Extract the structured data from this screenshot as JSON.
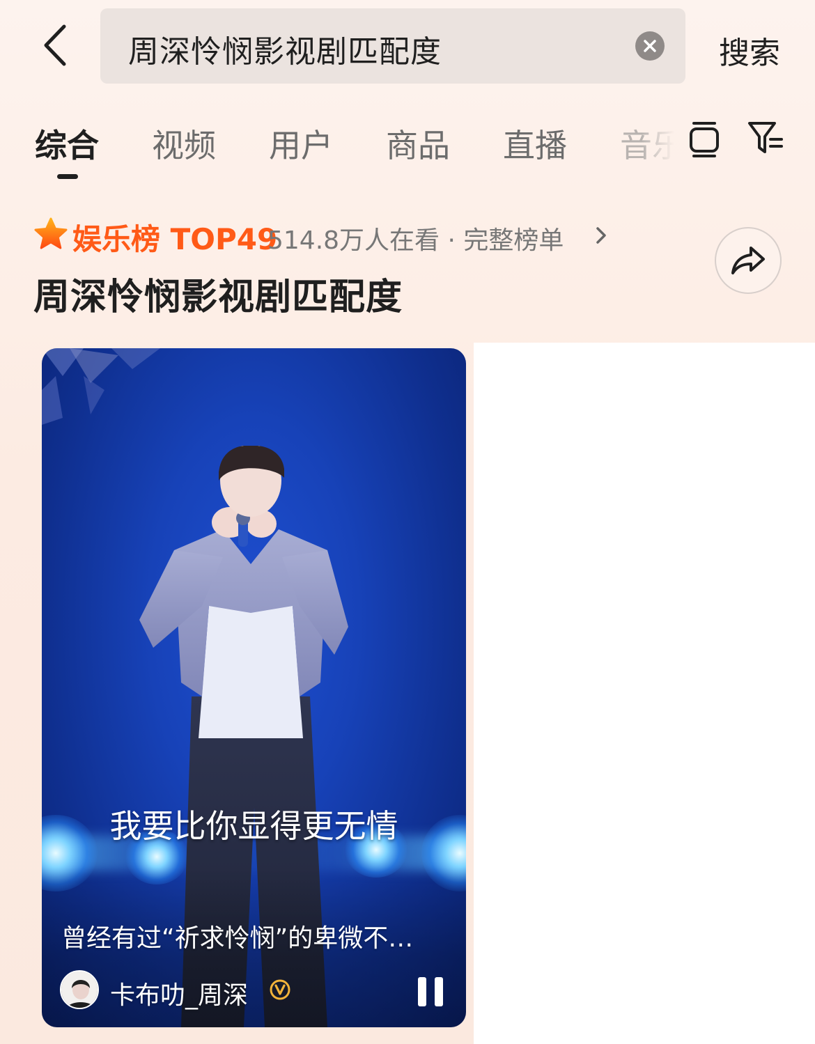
{
  "header": {
    "search_value": "周深怜悯影视剧匹配度",
    "search_button": "搜索"
  },
  "tabs": [
    {
      "label": "综合",
      "active": true
    },
    {
      "label": "视频",
      "active": false
    },
    {
      "label": "用户",
      "active": false
    },
    {
      "label": "商品",
      "active": false
    },
    {
      "label": "直播",
      "active": false
    },
    {
      "label": "音乐",
      "active": false
    }
  ],
  "ranking": {
    "label": "娱乐榜 TOP49",
    "meta": "514.8万人在看 · 完整榜单",
    "accent_color": "#ff5a17"
  },
  "topic": {
    "title": "周深怜悯影视剧匹配度"
  },
  "video": {
    "lyric": "我要比你显得更无情",
    "caption": "曾经有过“祈求怜悯”的卑微不…",
    "author": "卡布叻_周深",
    "verified_icon": "verified-badge-icon",
    "state": "playing"
  },
  "icons": {
    "back": "chevron-left-icon",
    "clear": "clear-icon",
    "layer": "layer-icon",
    "filter": "filter-icon",
    "star": "star-icon",
    "share": "share-icon",
    "pause": "pause-icon"
  }
}
